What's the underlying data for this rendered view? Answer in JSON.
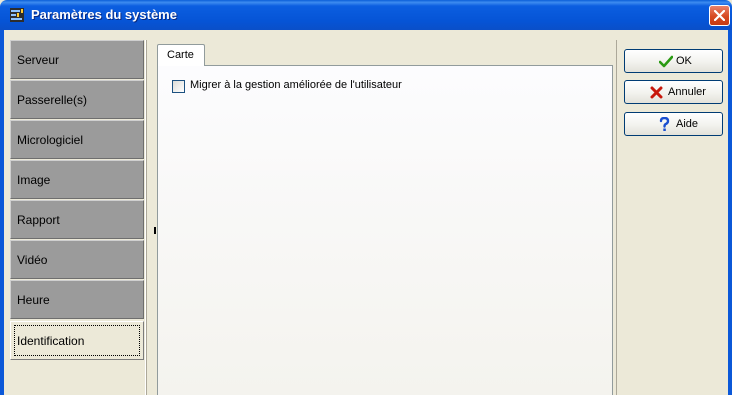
{
  "window": {
    "title": "Paramètres du système",
    "icon": "settings-app-icon",
    "close_icon": "close-icon",
    "accent": "#0a54d6",
    "close_color": "#d74a22"
  },
  "sidebar": {
    "items": [
      {
        "label": "Serveur",
        "selected": false
      },
      {
        "label": "Passerelle(s)",
        "selected": false
      },
      {
        "label": "Micrologiciel",
        "selected": false
      },
      {
        "label": "Image",
        "selected": false
      },
      {
        "label": "Rapport",
        "selected": false
      },
      {
        "label": "Vidéo",
        "selected": false
      },
      {
        "label": "Heure",
        "selected": false
      },
      {
        "label": "Identification",
        "selected": true
      }
    ]
  },
  "main": {
    "tabs": [
      {
        "label": "Carte",
        "active": true
      }
    ],
    "checkbox": {
      "label": "Migrer à la gestion améliorée de l'utilisateur",
      "checked": false
    }
  },
  "actions": {
    "ok_label": "OK",
    "ok_icon": "checkmark-icon",
    "cancel_label": "Annuler",
    "cancel_icon": "x-icon",
    "help_label": "Aide",
    "help_icon": "question-icon"
  }
}
